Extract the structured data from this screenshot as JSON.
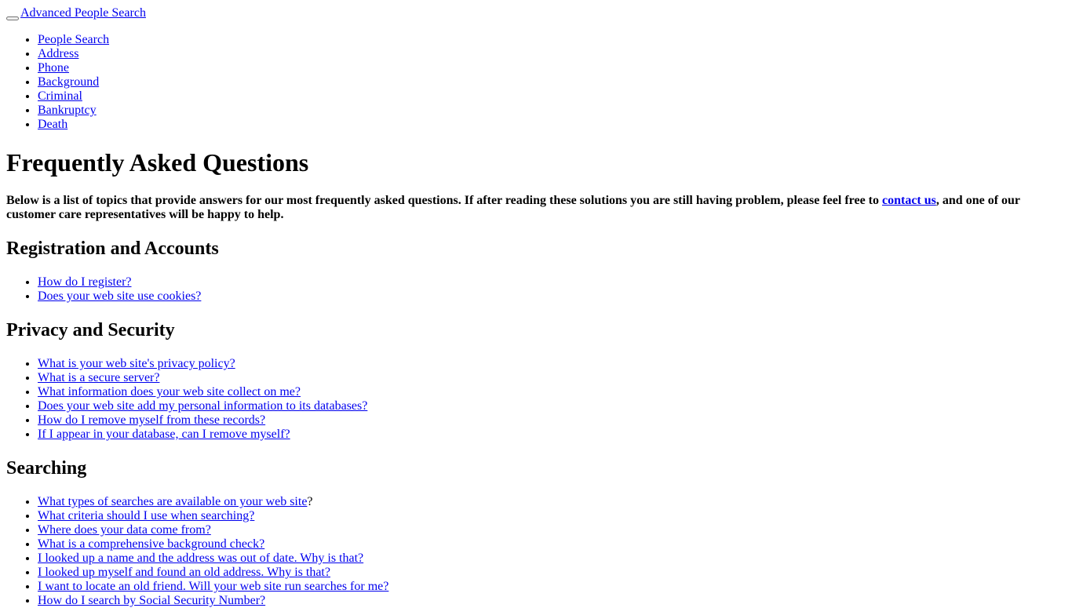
{
  "header": {
    "menu_toggle_icon": "menu-toggle-icon",
    "brand_link": "Advanced People Search"
  },
  "nav": {
    "items": [
      {
        "label": "People Search"
      },
      {
        "label": "Address"
      },
      {
        "label": "Phone"
      },
      {
        "label": "Background"
      },
      {
        "label": "Criminal"
      },
      {
        "label": "Bankruptcy"
      },
      {
        "label": "Death"
      }
    ]
  },
  "main": {
    "title": "Frequently Asked Questions",
    "intro": {
      "before_link": "Below is a list of topics that provide answers for our most frequently asked questions. If after reading these solutions you are still having problem, please feel free to ",
      "link": "contact us",
      "after_link": ", and one of our customer care representatives will be happy to help."
    },
    "sections": [
      {
        "heading": "Registration and Accounts",
        "questions": [
          {
            "link": "How do I register?",
            "suffix": ""
          },
          {
            "link": "Does your web site use cookies?",
            "suffix": ""
          }
        ]
      },
      {
        "heading": "Privacy and Security",
        "questions": [
          {
            "link": "What is your web site's privacy policy?",
            "suffix": ""
          },
          {
            "link": "What is a secure server?",
            "suffix": ""
          },
          {
            "link": "What information does your web site collect on me?",
            "suffix": ""
          },
          {
            "link": "Does your web site add my personal information to its databases?",
            "suffix": ""
          },
          {
            "link": "How do I remove myself from these records?",
            "suffix": ""
          },
          {
            "link": "If I appear in your database, can I remove myself?",
            "suffix": ""
          }
        ]
      },
      {
        "heading": "Searching",
        "questions": [
          {
            "link": "What types of searches are available on your web site",
            "suffix": "?"
          },
          {
            "link": "What criteria should I use when searching?",
            "suffix": ""
          },
          {
            "link": "Where does your data come from?",
            "suffix": ""
          },
          {
            "link": "What is a comprehensive background check?",
            "suffix": ""
          },
          {
            "link": "I looked up a name and the address was out of date. Why is that?",
            "suffix": ""
          },
          {
            "link": "I looked up myself and found an old address. Why is that?",
            "suffix": ""
          },
          {
            "link": "I want to locate an old friend. Will your web site run searches for me?",
            "suffix": ""
          },
          {
            "link": "How do I search by Social Security Number?",
            "suffix": ""
          }
        ]
      }
    ]
  }
}
